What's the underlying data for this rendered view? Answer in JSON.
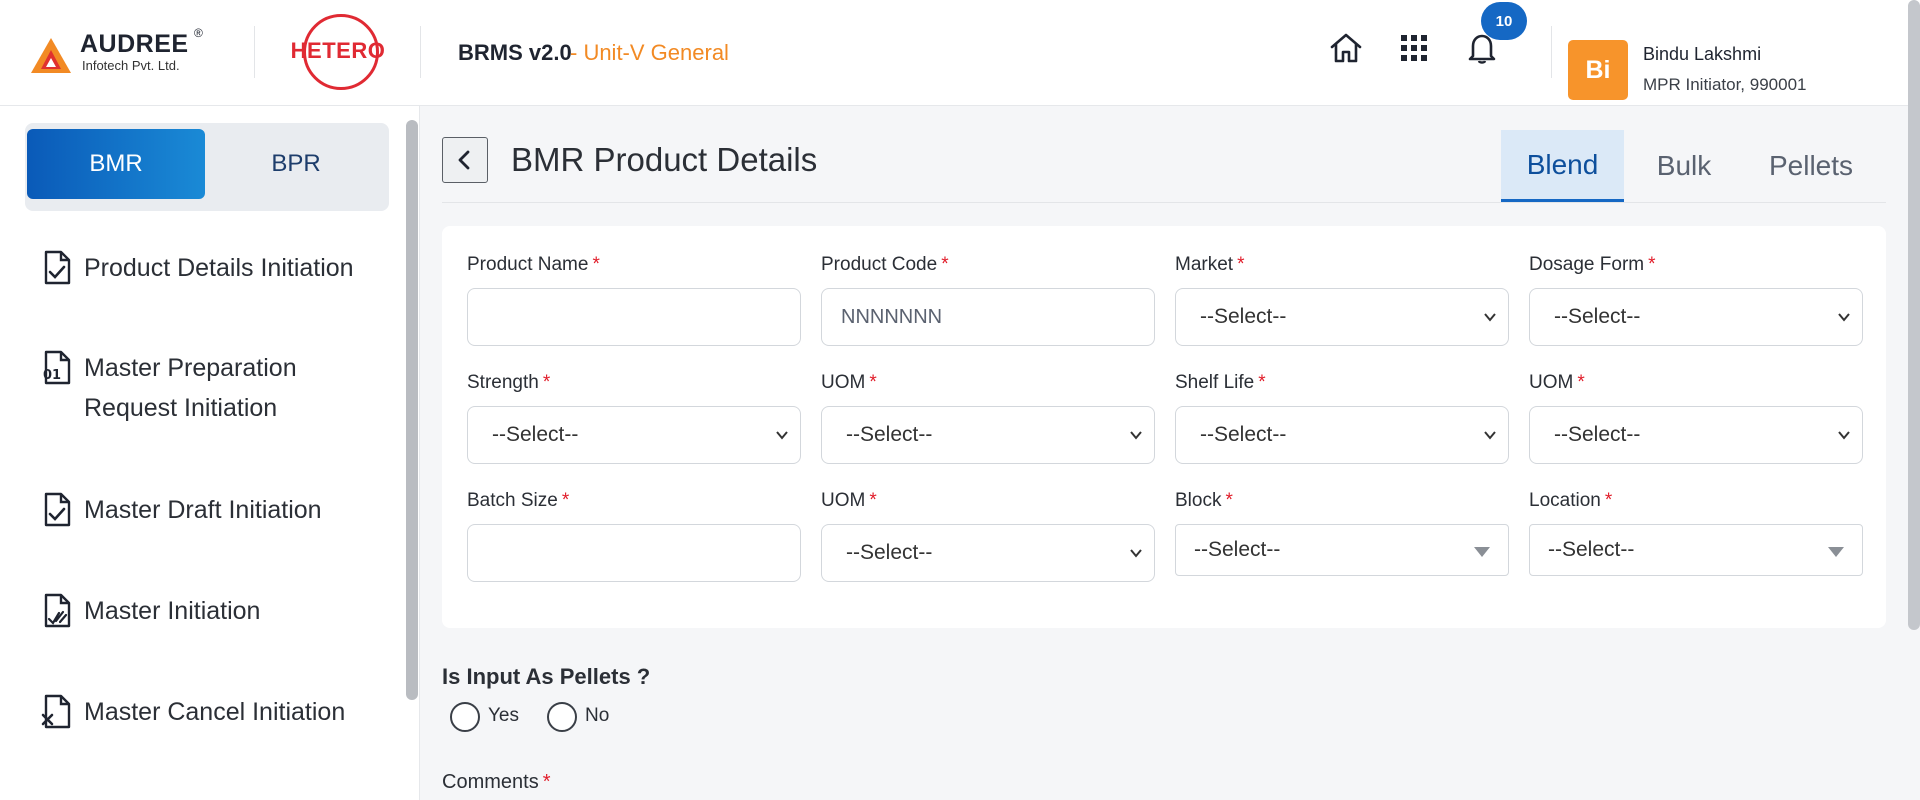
{
  "header": {
    "company_logo": {
      "name": "AUDREE",
      "registered": "®",
      "tagline": "Infotech Pvt. Ltd."
    },
    "client_logo": "HETERO",
    "app_title": "BRMS v2.0",
    "unit": "- Unit-V General",
    "notification_count": "10",
    "user": {
      "initials": "Bi",
      "name": "Bindu Lakshmi",
      "role": "MPR Initiator, 990001"
    },
    "icons": [
      "home-icon",
      "apps-grid-icon",
      "bell-icon"
    ]
  },
  "sidebar": {
    "segments": [
      {
        "label": "BMR",
        "active": true
      },
      {
        "label": "BPR",
        "active": false
      }
    ],
    "items": [
      {
        "label": "Product Details Initiation",
        "icon": "document-check-icon"
      },
      {
        "label": "Master Preparation",
        "label2": "Request Initiation",
        "icon": "binary-document-icon"
      },
      {
        "label": "Master Draft Initiation",
        "icon": "document-check-icon"
      },
      {
        "label": "Master Initiation",
        "icon": "document-signature-icon"
      },
      {
        "label": "Master Cancel Initiation",
        "icon": "document-cancel-icon"
      }
    ]
  },
  "main": {
    "title": "BMR Product Details",
    "tabs": [
      {
        "label": "Blend",
        "active": true
      },
      {
        "label": "Bulk",
        "active": false
      },
      {
        "label": "Pellets",
        "active": false
      }
    ],
    "form": {
      "product_name": {
        "label": "Product Name",
        "value": ""
      },
      "product_code": {
        "label": "Product Code",
        "placeholder": "NNNNNNN"
      },
      "market": {
        "label": "Market",
        "value": "--Select--"
      },
      "dosage_form": {
        "label": "Dosage Form",
        "value": "--Select--"
      },
      "strength": {
        "label": "Strength",
        "value": "--Select--"
      },
      "strength_uom": {
        "label": "UOM",
        "value": "--Select--"
      },
      "shelf_life": {
        "label": "Shelf Life",
        "value": "--Select--"
      },
      "shelf_life_uom": {
        "label": "UOM",
        "value": "--Select--"
      },
      "batch_size": {
        "label": "Batch Size",
        "value": ""
      },
      "batch_size_uom": {
        "label": "UOM",
        "value": "--Select--"
      },
      "block": {
        "label": "Block",
        "value": "--Select--"
      },
      "location": {
        "label": "Location",
        "value": "--Select--"
      },
      "required_mark": "*"
    },
    "input_as_pellets": {
      "question": "Is Input As Pellets ?",
      "options": [
        "Yes",
        "No"
      ]
    },
    "comments": {
      "label": "Comments"
    }
  },
  "colors": {
    "brand_blue": "#1568c4",
    "accent_orange": "#f28a24",
    "required_red": "#e11d2a",
    "hetero_red": "#e02a33"
  }
}
